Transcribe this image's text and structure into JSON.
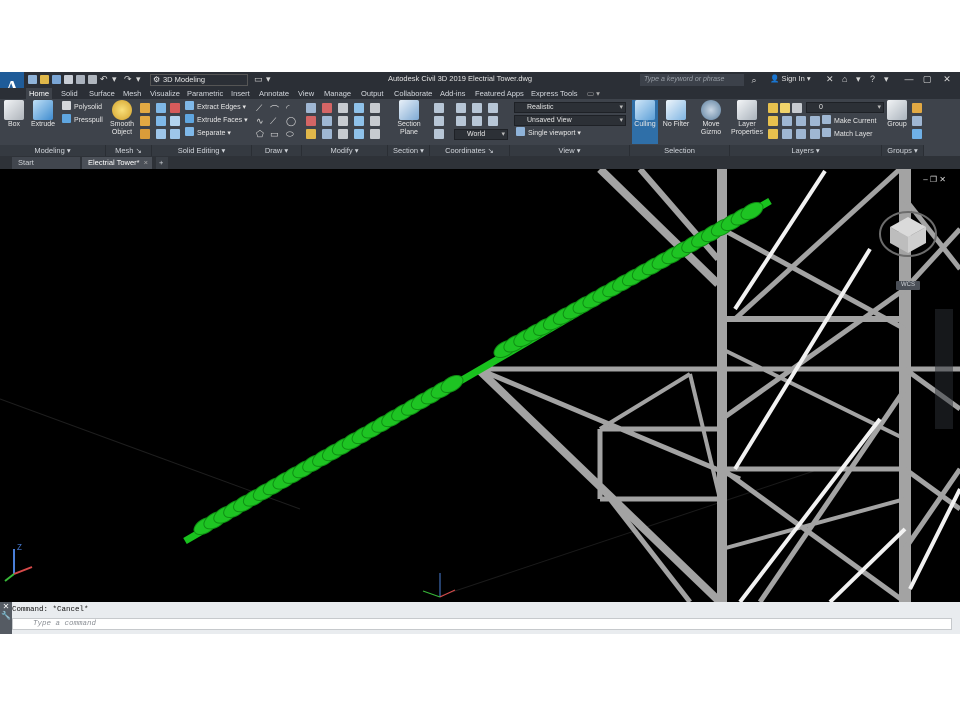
{
  "title_bar": {
    "workspace": "3D Modeling",
    "app_title": "Autodesk Civil 3D 2019   Electrial Tower.dwg",
    "search_placeholder": "Type a keyword or phrase",
    "sign_in": "Sign In",
    "logo_letter": "A"
  },
  "ribbon_tabs": [
    "Home",
    "Solid",
    "Surface",
    "Mesh",
    "Visualize",
    "Parametric",
    "Insert",
    "Annotate",
    "View",
    "Manage",
    "Output",
    "Collaborate",
    "Add-ins",
    "Featured Apps",
    "Express Tools"
  ],
  "ribbon": {
    "modeling": {
      "title": "Modeling",
      "box": "Box",
      "extrude": "Extrude",
      "polysolid": "Polysolid",
      "presspull": "Presspull"
    },
    "mesh": {
      "title": "Mesh",
      "smooth": "Smooth",
      "object": "Object"
    },
    "solid_editing": {
      "title": "Solid Editing",
      "extract_edges": "Extract Edges",
      "extrude_faces": "Extrude Faces",
      "separate": "Separate"
    },
    "draw": {
      "title": "Draw"
    },
    "modify": {
      "title": "Modify"
    },
    "section": {
      "title": "Section",
      "btn_line1": "Section",
      "btn_line2": "Plane"
    },
    "coordinates": {
      "title": "Coordinates",
      "world": "World"
    },
    "view": {
      "title": "View",
      "visual_style": "Realistic",
      "named_view": "Unsaved View",
      "viewport": "Single viewport"
    },
    "selection": {
      "title": "Selection",
      "culling": "Culling",
      "no_filter": "No Filter",
      "move_gizmo_1": "Move",
      "move_gizmo_2": "Gizmo"
    },
    "layers": {
      "title": "Layers",
      "layer_props_1": "Layer",
      "layer_props_2": "Properties",
      "current_layer": "0",
      "make_current": "Make Current",
      "match_layer": "Match Layer"
    },
    "groups": {
      "title": "Groups",
      "group": "Group"
    }
  },
  "file_tabs": [
    "Start",
    "Electrial Tower*"
  ],
  "viewcube": {
    "wcs_label": "WCS"
  },
  "command": {
    "history": "Command: *Cancel*",
    "placeholder": "Type a command"
  },
  "colors": {
    "insulator_green": "#19c21e",
    "tower_gray": "#9a9a9a",
    "background": "#000000",
    "ribbon_bg": "#3e434b",
    "active_tab": "#3e434b"
  }
}
